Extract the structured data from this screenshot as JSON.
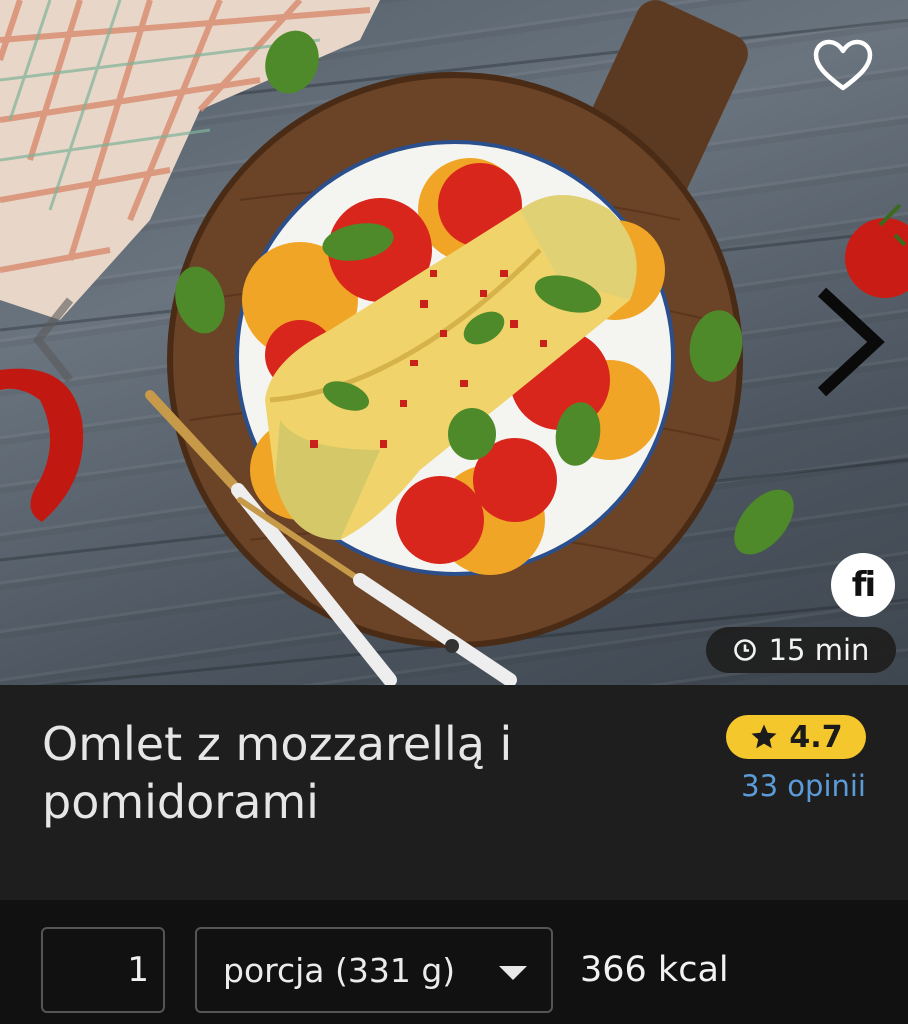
{
  "recipe": {
    "title": "Omlet z mozzarellą i pomidorami",
    "cook_time": "15 min",
    "rating": "4.7",
    "reviews": "33 opinii",
    "brand_logo_text": "fi"
  },
  "portion": {
    "quantity": "1",
    "unit": "porcja (331 g)",
    "calories": "366 kcal"
  },
  "icons": {
    "favorite": "heart-outline-icon",
    "previous": "chevron-left-icon",
    "next": "chevron-right-icon",
    "time": "clock-icon",
    "rating": "star-icon",
    "unit_dropdown": "caret-down-icon"
  },
  "colors": {
    "rating_badge": "#f4c82c",
    "reviews_link": "#5b9bd8",
    "title_panel_bg": "#1e1e1e",
    "portion_bar_bg": "#111111"
  }
}
